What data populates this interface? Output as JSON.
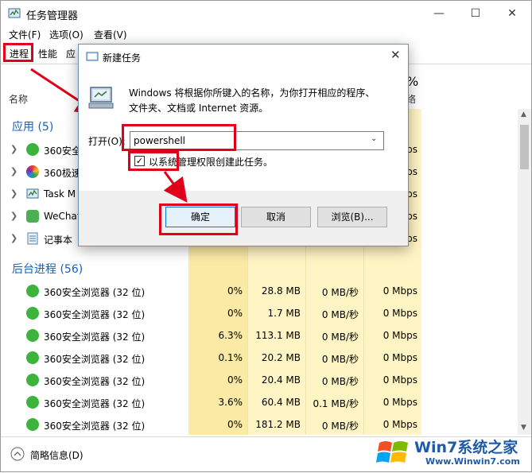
{
  "window": {
    "title": "任务管理器",
    "menu": [
      "文件(F)",
      "选项(O)",
      "查看(V)"
    ],
    "tabs": [
      "进程",
      "性能",
      "应"
    ],
    "footer_label": "简略信息(D)"
  },
  "columns": {
    "name": "名称",
    "pct": "%",
    "net": "络"
  },
  "groups": {
    "apps": "应用 (5)",
    "background": "后台进程 (56)"
  },
  "apps": [
    {
      "name": "360安全",
      "net": "Mbps"
    },
    {
      "name": "360极速",
      "net": "Mbps"
    },
    {
      "name": "Task M",
      "net": "Mbps"
    },
    {
      "name": "WeChat",
      "net": "Mbps"
    },
    {
      "name": "记事本",
      "net": "Mbps"
    }
  ],
  "processes": [
    {
      "name": "360安全浏览器 (32 位)",
      "cpu": "0%",
      "mem": "28.8 MB",
      "disk": "0 MB/秒",
      "net": "0 Mbps"
    },
    {
      "name": "360安全浏览器 (32 位)",
      "cpu": "0%",
      "mem": "1.7 MB",
      "disk": "0 MB/秒",
      "net": "0 Mbps"
    },
    {
      "name": "360安全浏览器 (32 位)",
      "cpu": "6.3%",
      "mem": "113.1 MB",
      "disk": "0 MB/秒",
      "net": "0 Mbps"
    },
    {
      "name": "360安全浏览器 (32 位)",
      "cpu": "0.1%",
      "mem": "20.2 MB",
      "disk": "0 MB/秒",
      "net": "0 Mbps"
    },
    {
      "name": "360安全浏览器 (32 位)",
      "cpu": "0%",
      "mem": "20.4 MB",
      "disk": "0 MB/秒",
      "net": "0 Mbps"
    },
    {
      "name": "360安全浏览器 (32 位)",
      "cpu": "3.6%",
      "mem": "60.4 MB",
      "disk": "0.1 MB/秒",
      "net": "0 Mbps"
    },
    {
      "name": "360安全浏览器 (32 位)",
      "cpu": "0%",
      "mem": "181.2 MB",
      "disk": "0 MB/秒",
      "net": "0 Mbps"
    }
  ],
  "dialog": {
    "title": "新建任务",
    "description": "Windows 将根据你所键入的名称，为你打开相应的程序、文件夹、文档或 Internet 资源。",
    "open_label": "打开(O):",
    "input_value": "powershell",
    "checkbox_label": "以系统管理权限创建此任务。",
    "ok": "确定",
    "cancel": "取消",
    "browse": "浏览(B)..."
  },
  "watermark": {
    "brand": "Win7系统之家",
    "url": "Www.Winwin7.com"
  },
  "colors": {
    "red_highlight": "#e0001a",
    "heat_light": "#fff4c4",
    "heat_mid": "#fbe9a6",
    "group_blue": "#1a5fb4",
    "app_green": "#3cb33c"
  }
}
